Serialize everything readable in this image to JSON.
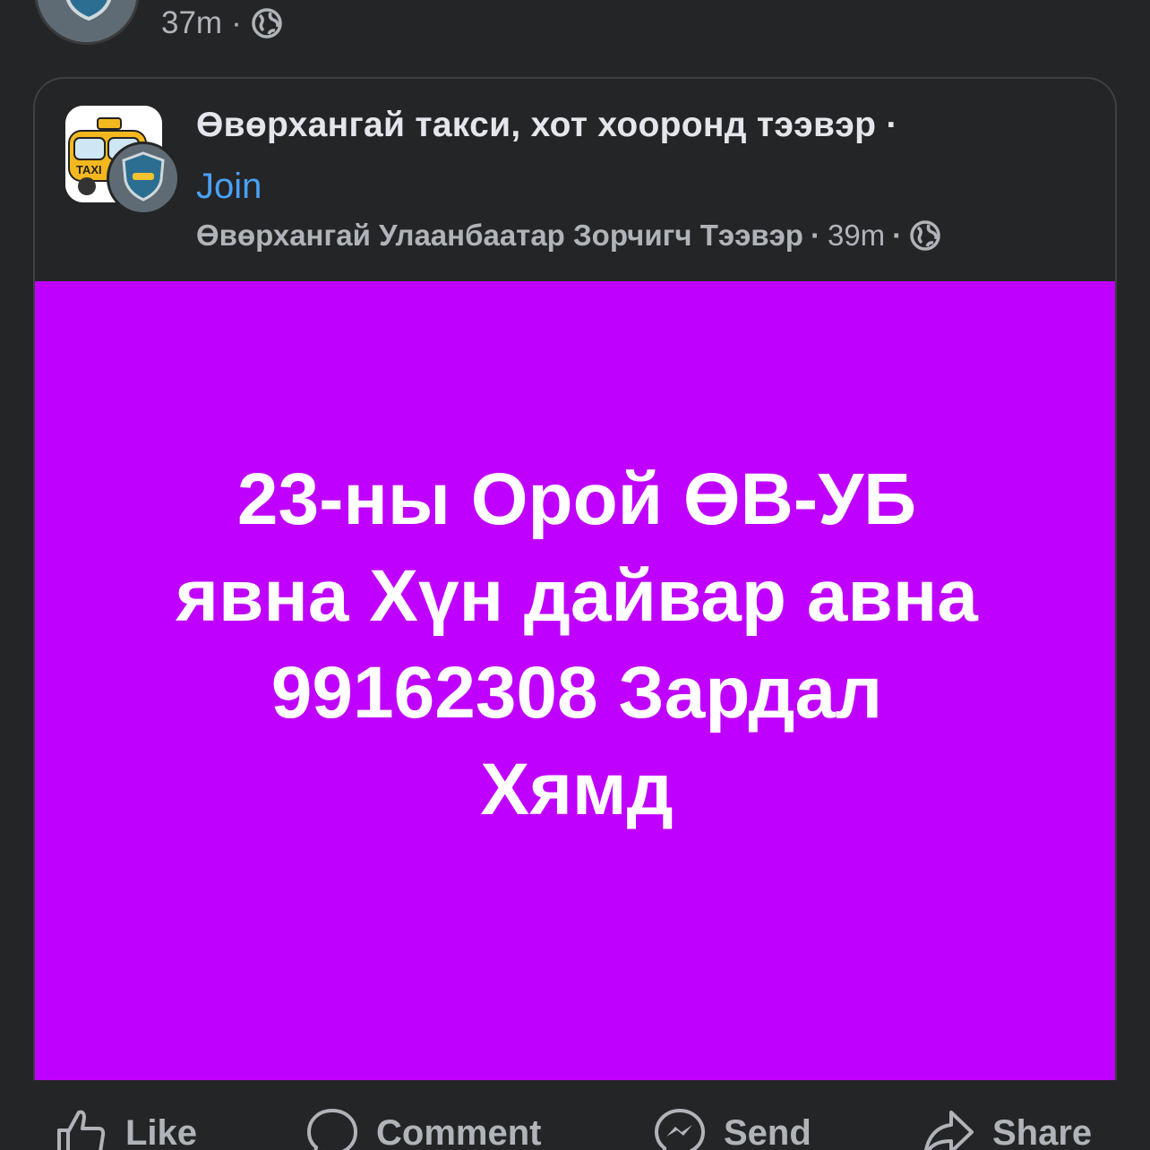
{
  "top": {
    "time": "37m",
    "separator": "·"
  },
  "shared_post": {
    "group_name": "Өвөрхангай такси, хот хооронд тээвэр",
    "title_separator": "·",
    "join_label": "Join",
    "author": "Өвөрхангай Улаанбаатар Зорчигч Тээвэр",
    "meta_separator_1": "·",
    "time": "39m",
    "meta_separator_2": "·",
    "logo_text": "TAXI",
    "banner": {
      "background": "#c000ff",
      "line1": "23-ны Орой ӨВ-УБ",
      "line2": "явна Хүн дайвар авна",
      "line3": "99162308 Зардал",
      "line4": "Хямд"
    }
  },
  "actions": {
    "like": "Like",
    "comment": "Comment",
    "send": "Send",
    "share": "Share"
  },
  "colors": {
    "background": "#242526",
    "link": "#4aa1f5",
    "secondary_text": "#b0b3b8"
  }
}
